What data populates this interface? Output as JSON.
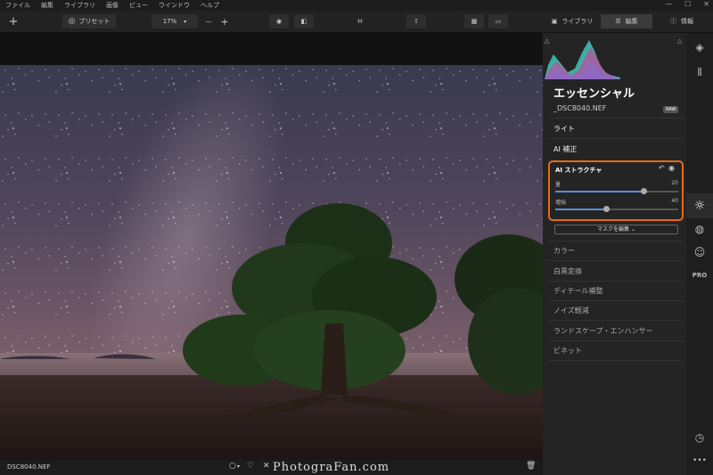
{
  "menu": {
    "items": [
      "ファイル",
      "編集",
      "ライブラリ",
      "画像",
      "ビュー",
      "ウインドウ",
      "ヘルプ"
    ],
    "window_controls": [
      "—",
      "☐",
      "✕"
    ]
  },
  "toolbar": {
    "add_label": "+",
    "preset_label": "プリセット",
    "zoom_value": "17%",
    "zoom_minus": "—",
    "zoom_plus": "+",
    "library_tab": "ライブラリ",
    "edit_tab": "編集",
    "info_tab": "情報"
  },
  "panel": {
    "title": "エッセンシャル",
    "filename": "_DSC8040.NEF",
    "raw_badge": "RAW",
    "sections_top": [
      "ライト",
      "AI 補正"
    ],
    "ai_structure": {
      "title": "AI ストラクチャ",
      "sliders": [
        {
          "label": "量",
          "value": "20",
          "fraction": 0.72
        },
        {
          "label": "増強",
          "value": "40",
          "fraction": 0.42
        }
      ]
    },
    "mask_button": "マスクを編集 ⌄",
    "sections_bottom": [
      "カラー",
      "白黒変換",
      "ディテール補整",
      "ノイズ軽減",
      "ランドスケープ・エンハンサー",
      "ビネット"
    ]
  },
  "status": {
    "filename": "DSC8040.NEF",
    "watermark": "PhotograFan.com"
  },
  "accent_color": "#e86a17",
  "icons": [
    "layers-icon",
    "compare-icon",
    "sun-icon",
    "palette-icon",
    "face-icon",
    "pro-icon",
    "history-icon",
    "more-icon"
  ]
}
